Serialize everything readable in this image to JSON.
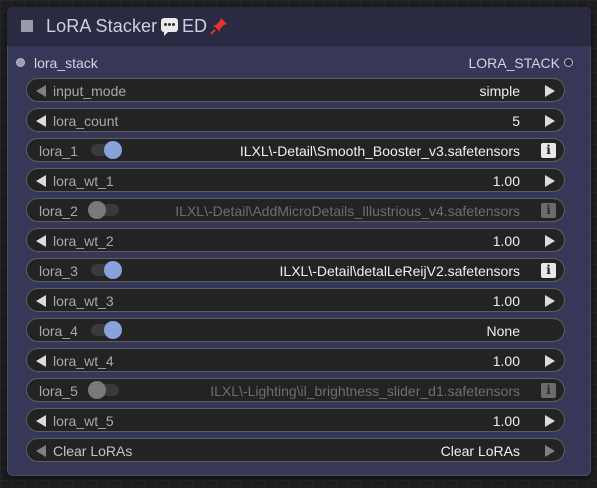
{
  "node": {
    "title": "LoRA Stacker",
    "badge_text": "ED",
    "badge_icon": "speech-bubble-icon",
    "pin_icon": "pushpin-icon",
    "colors": {
      "node_bg": "#373757",
      "title_bg": "#2a2a42",
      "toggle_on": "#8aa2dc"
    }
  },
  "slots": {
    "input": "lora_stack",
    "output": "LORA_STACK"
  },
  "widgets": {
    "input_mode": {
      "label": "input_mode",
      "value": "simple"
    },
    "lora_count": {
      "label": "lora_count",
      "value": "5"
    },
    "lora_1": {
      "label": "lora_1",
      "value": "ILXL\\-Detail\\Smooth_Booster_v3.safetensors",
      "enabled": true
    },
    "lora_wt_1": {
      "label": "lora_wt_1",
      "value": "1.00"
    },
    "lora_2": {
      "label": "lora_2",
      "value": "ILXL\\-Detail\\AddMicroDetails_Illustrious_v4.safetensors",
      "enabled": false
    },
    "lora_wt_2": {
      "label": "lora_wt_2",
      "value": "1.00"
    },
    "lora_3": {
      "label": "lora_3",
      "value": "ILXL\\-Detail\\detalLeReijV2.safetensors",
      "enabled": true
    },
    "lora_wt_3": {
      "label": "lora_wt_3",
      "value": "1.00"
    },
    "lora_4": {
      "label": "lora_4",
      "value": "None",
      "enabled": true
    },
    "lora_wt_4": {
      "label": "lora_wt_4",
      "value": "1.00"
    },
    "lora_5": {
      "label": "lora_5",
      "value": "ILXL\\-Lighting\\il_brightness_slider_d1.safetensors",
      "enabled": false
    },
    "lora_wt_5": {
      "label": "lora_wt_5",
      "value": "1.00"
    },
    "clear": {
      "label": "Clear LoRAs",
      "value": "Clear LoRAs"
    }
  }
}
